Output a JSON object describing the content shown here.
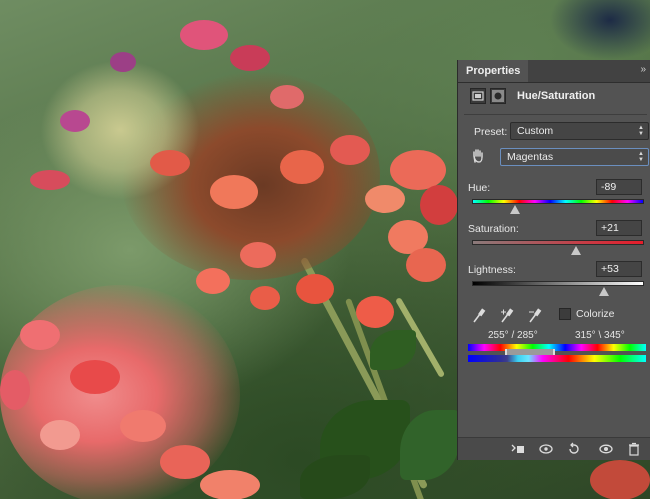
{
  "panel": {
    "tab_label": "Properties",
    "menu_glyph": "»",
    "title": "Hue/Saturation",
    "preset": {
      "label": "Preset:",
      "value": "Custom"
    },
    "channel": {
      "value": "Magentas"
    },
    "hue": {
      "label": "Hue:",
      "value": "-89",
      "level": -89,
      "min": -180,
      "max": 180
    },
    "saturation": {
      "label": "Saturation:",
      "value": "+21",
      "level": 21,
      "min": -100,
      "max": 100
    },
    "lightness": {
      "label": "Lightness:",
      "value": "+53",
      "level": 53,
      "min": -100,
      "max": 100
    },
    "colorize": {
      "label": "Colorize",
      "checked": false
    },
    "range_left": "255° / 285°",
    "range_right": "315° \\ 345°",
    "bottom_icons": [
      "clip-to-layer-icon",
      "view-previous-icon",
      "reset-icon",
      "visibility-icon",
      "delete-icon"
    ]
  },
  "colors": {
    "panel_bg": "#535353",
    "header_bg": "#424242",
    "field_bg": "#454545",
    "highlight_border": "#6b8fbf"
  }
}
